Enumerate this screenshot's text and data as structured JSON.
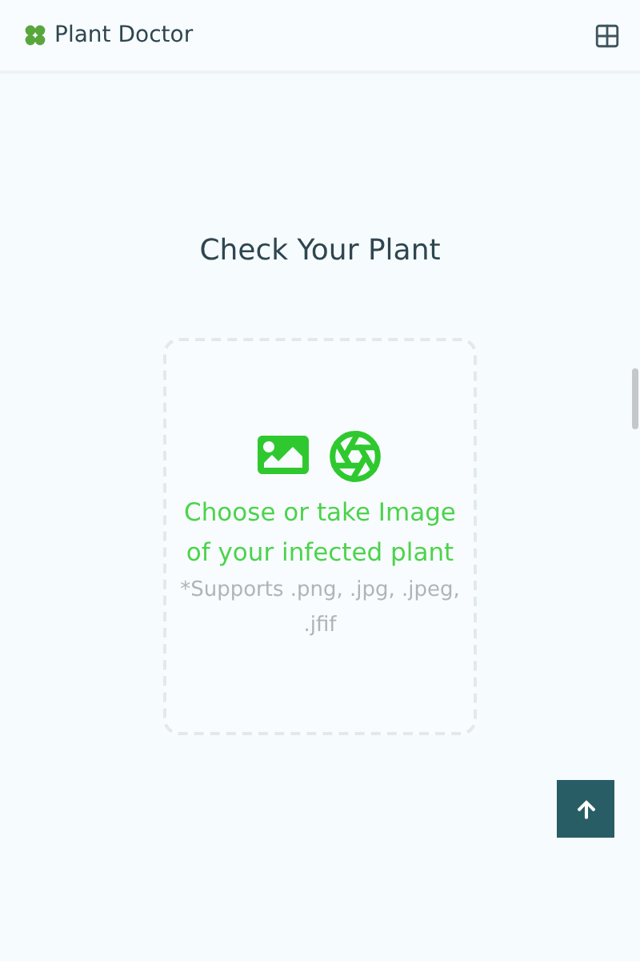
{
  "header": {
    "title": "Plant Doctor"
  },
  "main": {
    "heading": "Check Your Plant",
    "upload": {
      "prompt_lines": [
        "Choose or take Image",
        "of your infected plant"
      ],
      "hint": "*Supports .png, .jpg, .jpeg, .jfif"
    }
  }
}
